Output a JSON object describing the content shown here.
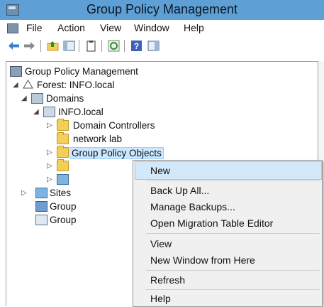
{
  "window": {
    "title": "Group Policy Management"
  },
  "menubar": {
    "items": [
      "File",
      "Action",
      "View",
      "Window",
      "Help"
    ]
  },
  "toolbar": {
    "icons": [
      "back-arrow-icon",
      "forward-arrow-icon",
      "up-folder-icon",
      "show-hide-tree-icon",
      "properties-icon",
      "refresh-icon",
      "help-icon",
      "show-pane-icon"
    ]
  },
  "tree": {
    "root": "Group Policy Management",
    "forest": "Forest: INFO.local",
    "domains": "Domains",
    "domain": "INFO.local",
    "domain_controllers": "Domain Controllers",
    "network_lab": "network lab",
    "gpo": "Group Policy Objects",
    "sites": "Sites",
    "group_modeling": "Group",
    "group_results": "Group"
  },
  "context_menu": {
    "items": [
      "New",
      "Back Up All...",
      "Manage Backups...",
      "Open Migration Table Editor",
      "View",
      "New Window from Here",
      "Refresh",
      "Help"
    ],
    "highlighted": "New"
  },
  "colors": {
    "titlebar": "#5ea0d6",
    "menu_highlight": "#d3e8f8",
    "selection": "#cce8ff"
  }
}
